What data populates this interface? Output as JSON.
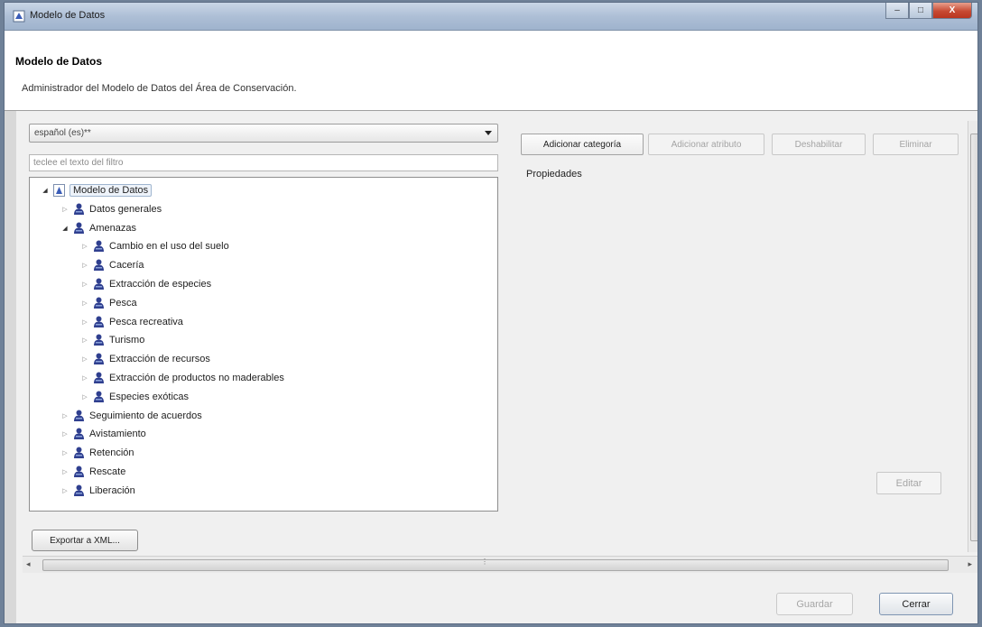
{
  "window": {
    "title": "Modelo de Datos",
    "buttons": {
      "minimize": "–",
      "maximize": "□",
      "close": "X"
    }
  },
  "header": {
    "title": "Modelo de Datos",
    "description": "Administrador del Modelo de Datos del Área de Conservación."
  },
  "left_panel": {
    "language_select": "español (es)**",
    "filter_placeholder": "teclee el texto del filtro",
    "tree": [
      {
        "label": "Modelo de Datos",
        "level": 0,
        "expanded": true,
        "root": true
      },
      {
        "label": "Datos generales",
        "level": 1,
        "expanded": false
      },
      {
        "label": "Amenazas",
        "level": 1,
        "expanded": true
      },
      {
        "label": "Cambio en el uso del suelo",
        "level": 2,
        "expanded": false
      },
      {
        "label": "Cacería",
        "level": 2,
        "expanded": false
      },
      {
        "label": "Extracción de especies",
        "level": 2,
        "expanded": false
      },
      {
        "label": "Pesca",
        "level": 2,
        "expanded": false
      },
      {
        "label": "Pesca recreativa",
        "level": 2,
        "expanded": false
      },
      {
        "label": "Turismo",
        "level": 2,
        "expanded": false
      },
      {
        "label": "Extracción de recursos",
        "level": 2,
        "expanded": false
      },
      {
        "label": "Extracción de productos no maderables",
        "level": 2,
        "expanded": false
      },
      {
        "label": "Especies exóticas",
        "level": 2,
        "expanded": false
      },
      {
        "label": "Seguimiento de acuerdos",
        "level": 1,
        "expanded": false
      },
      {
        "label": "Avistamiento",
        "level": 1,
        "expanded": false
      },
      {
        "label": "Retención",
        "level": 1,
        "expanded": false
      },
      {
        "label": "Rescate",
        "level": 1,
        "expanded": false
      },
      {
        "label": "Liberación",
        "level": 1,
        "expanded": false
      }
    ],
    "export_button": "Exportar a XML..."
  },
  "right_panel": {
    "buttons": [
      {
        "label": "Adicionar categoría",
        "enabled": true
      },
      {
        "label": "Adicionar atributo",
        "enabled": false
      },
      {
        "label": "Deshabilitar",
        "enabled": false
      },
      {
        "label": "Eliminar",
        "enabled": false
      }
    ],
    "properties_label": "Propiedades",
    "edit_button": "Editar"
  },
  "footer": {
    "save_button": "Guardar",
    "close_button": "Cerrar"
  },
  "colors": {
    "node_icon": "#2f3f8f",
    "root_icon": "#3b5db8",
    "close_red": "#c74a33"
  }
}
